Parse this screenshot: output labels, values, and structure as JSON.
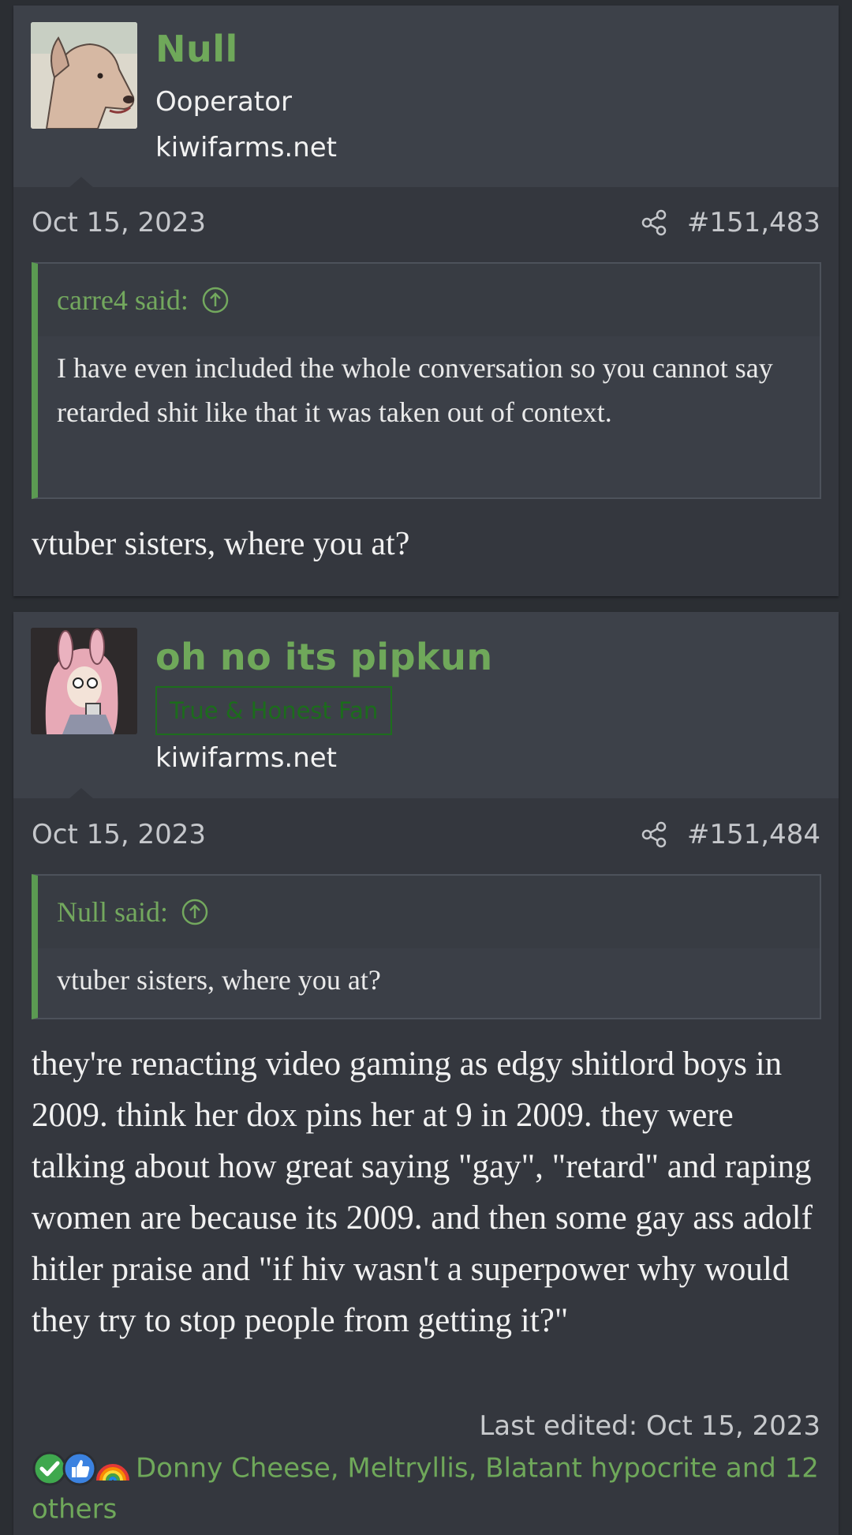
{
  "posts": [
    {
      "author": "Null",
      "user_title": "Ooperator",
      "site": "kiwifarms.net",
      "date": "Oct 15, 2023",
      "post_number": "#151,483",
      "quote": {
        "author_label": "carre4 said:",
        "text": "I have even included the whole conversation so you cannot say retarded shit like that it was taken out of context."
      },
      "body": "vtuber sisters, where you at?"
    },
    {
      "author": "oh no its pipkun",
      "user_badge": "True & Honest Fan",
      "site": "kiwifarms.net",
      "date": "Oct 15, 2023",
      "post_number": "#151,484",
      "quote": {
        "author_label": "Null said:",
        "text": "vtuber sisters, where you at?"
      },
      "body": "they're renacting video gaming as edgy shitlord boys in 2009. think her dox pins her at 9 in 2009. they were talking about how great saying \"gay\", \"retard\" and raping women are because its 2009. and then some gay ass adolf hitler praise and \"if hiv wasn't a superpower why would they try to stop people from getting it?\"",
      "last_edited": "Last edited: Oct 15, 2023",
      "reactions": {
        "icons": [
          "checkmark-icon",
          "thumbs-up-icon",
          "rainbow-icon"
        ],
        "list": "Donny Cheese, Meltryllis, Blatant hypocrite and 12 others"
      }
    }
  ],
  "colors": {
    "accent": "#6fa85a",
    "background": "#2b2e33",
    "post_bg": "#34373e",
    "user_block_bg": "#3d4149",
    "badge": "#1c6c1c"
  }
}
